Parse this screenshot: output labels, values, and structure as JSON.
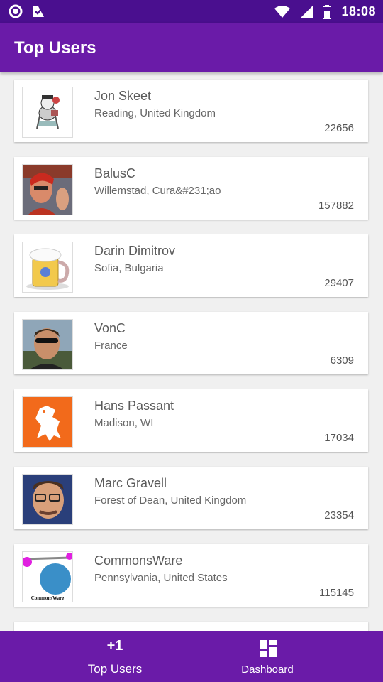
{
  "status_bar": {
    "time": "18:08",
    "icons": [
      "circle-app-icon",
      "checkbox-app-icon",
      "wifi-icon",
      "signal-icon",
      "battery-icon"
    ]
  },
  "app_bar": {
    "title": "Top Users"
  },
  "users": [
    {
      "name": "Jon Skeet",
      "location": "Reading, United Kingdom",
      "reputation": "22656",
      "avatar": "cartoon-avatar"
    },
    {
      "name": "BalusC",
      "location": "Willemstad, Cura&#231;ao",
      "reputation": "157882",
      "avatar": "photo-avatar-red"
    },
    {
      "name": "Darin Dimitrov",
      "location": "Sofia, Bulgaria",
      "reputation": "29407",
      "avatar": "beer-mug-avatar"
    },
    {
      "name": "VonC",
      "location": "France",
      "reputation": "6309",
      "avatar": "photo-avatar-sunglasses"
    },
    {
      "name": "Hans Passant",
      "location": "Madison, WI",
      "reputation": "17034",
      "avatar": "lion-avatar"
    },
    {
      "name": "Marc Gravell",
      "location": "Forest of Dean, United Kingdom",
      "reputation": "23354",
      "avatar": "photo-avatar-glasses"
    },
    {
      "name": "CommonsWare",
      "location": "Pennsylvania, United States",
      "reputation": "115145",
      "avatar": "commonsware-logo-avatar",
      "avatar_text": "CommonsWare"
    }
  ],
  "bottom_nav": {
    "left": {
      "icon_text": "+1",
      "label": "Top Users"
    },
    "right": {
      "label": "Dashboard",
      "icon": "dashboard-icon"
    }
  },
  "colors": {
    "primary": "#6a1ba8",
    "status_bar": "#4a0f8f"
  }
}
